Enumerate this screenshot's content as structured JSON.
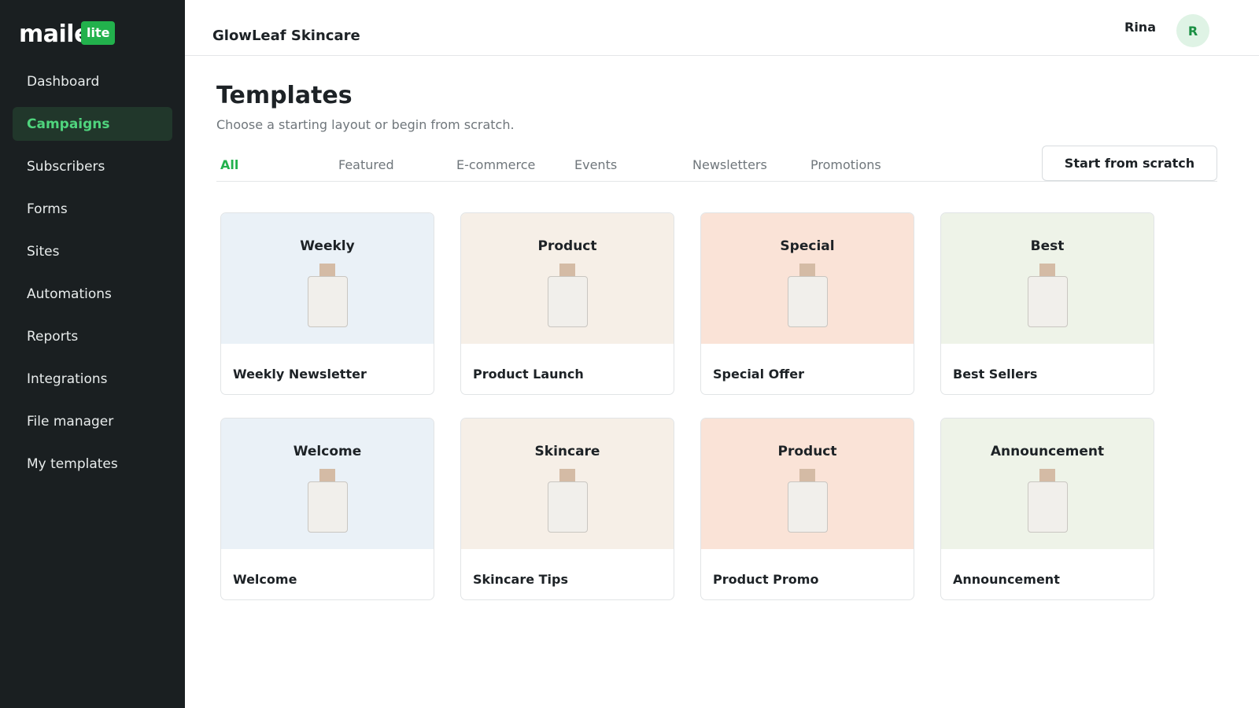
{
  "logo": {
    "text": "maile",
    "badge": "lite"
  },
  "sidebar": {
    "items": [
      {
        "label": "Dashboard"
      },
      {
        "label": "Campaigns"
      },
      {
        "label": "Subscribers"
      },
      {
        "label": "Forms"
      },
      {
        "label": "Sites"
      },
      {
        "label": "Automations"
      },
      {
        "label": "Reports"
      },
      {
        "label": "Integrations"
      },
      {
        "label": "File manager"
      },
      {
        "label": "My templates"
      }
    ],
    "active_index": 1
  },
  "header": {
    "brand": "GlowLeaf Skincare",
    "user_name": "Rina",
    "avatar_initial": "R"
  },
  "main": {
    "title": "Templates",
    "subtitle": "Choose a starting layout or begin from scratch.",
    "tabs": [
      {
        "label": "All"
      },
      {
        "label": "Featured"
      },
      {
        "label": "E-commerce"
      },
      {
        "label": "Events"
      },
      {
        "label": "Newsletters"
      },
      {
        "label": "Promotions"
      }
    ],
    "start_button": "Start from scratch",
    "templates": [
      {
        "thumb_title": "Weekly",
        "name": "Weekly Newsletter",
        "color": "#eaf1f7"
      },
      {
        "thumb_title": "Product",
        "name": "Product Launch",
        "color": "#f6efe7"
      },
      {
        "thumb_title": "Special",
        "name": "Special Offer",
        "color": "#fae3d7"
      },
      {
        "thumb_title": "Best",
        "name": "Best Sellers",
        "color": "#eef3e8"
      },
      {
        "thumb_title": "Welcome",
        "name": "Welcome",
        "color": "#eaf1f7"
      },
      {
        "thumb_title": "Skincare",
        "name": "Skincare Tips",
        "color": "#f6efe7"
      },
      {
        "thumb_title": "Product",
        "name": "Product Promo",
        "color": "#fae3d7"
      },
      {
        "thumb_title": "Announcement",
        "name": "Announcement",
        "color": "#eef3e8"
      }
    ]
  },
  "colors": {
    "accent": "#22b14c",
    "sidebar_bg": "#1a1f21",
    "active_nav_bg": "#21372b"
  },
  "icons": {
    "product": "bottle-icon"
  }
}
